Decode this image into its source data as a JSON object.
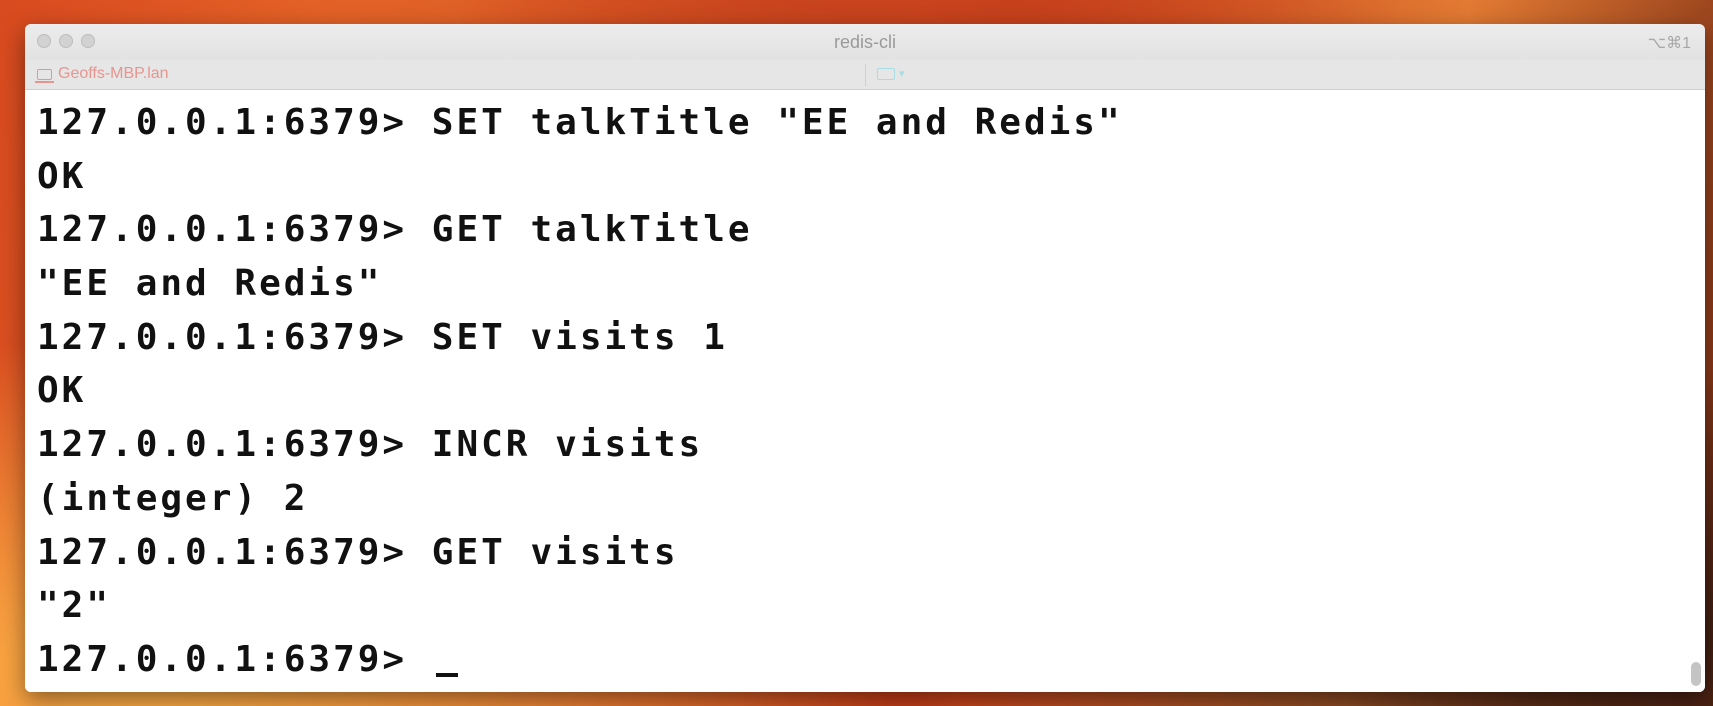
{
  "window": {
    "title": "redis-cli",
    "shortcut": "⌥⌘1",
    "tab": {
      "host_label": "Geoffs-MBP.lan",
      "host_icon": "computer-icon",
      "folder_icon": "folder-icon"
    }
  },
  "terminal": {
    "lines": [
      "127.0.0.1:6379> SET talkTitle \"EE and Redis\"",
      "OK",
      "127.0.0.1:6379> GET talkTitle",
      "\"EE and Redis\"",
      "127.0.0.1:6379> SET visits 1",
      "OK",
      "127.0.0.1:6379> INCR visits",
      "(integer) 2",
      "127.0.0.1:6379> GET visits",
      "\"2\""
    ],
    "prompt": "127.0.0.1:6379> "
  },
  "colors": {
    "terminal_text": "#111111",
    "terminal_background": "#ffffff",
    "host_label": "#e8948f"
  }
}
